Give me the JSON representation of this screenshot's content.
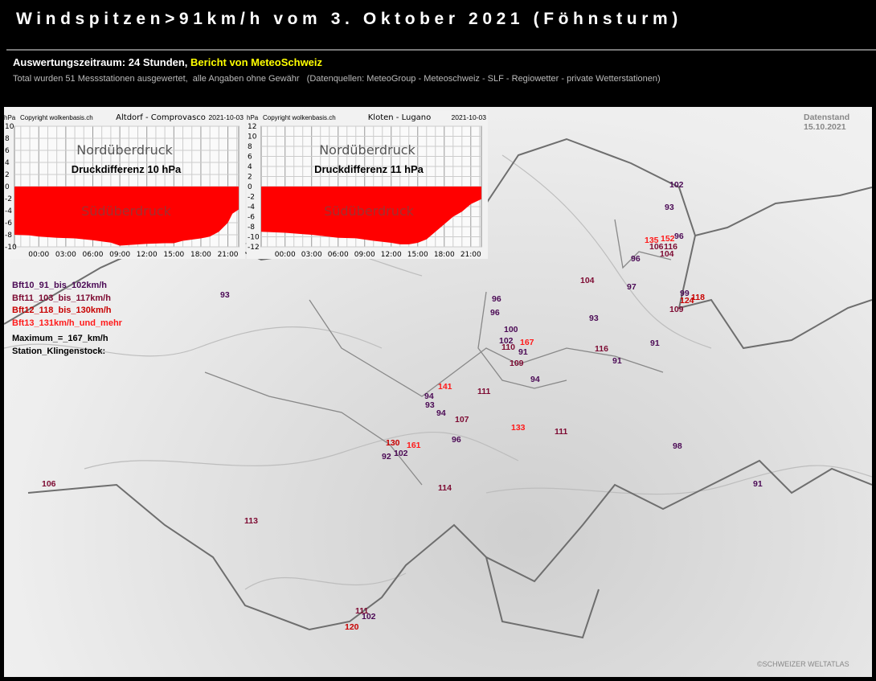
{
  "header": {
    "title": "Windspitzen>91km/h vom 3. Oktober 2021 (Föhnsturm)",
    "period": "Auswertungszeitraum: 24 Stunden,",
    "report": "Bericht von MeteoSchweiz",
    "info": "Total wurden 51 Messstationen ausgewertet,  alle Angaben ohne Gewähr   (Datenquellen: MeteoGroup - Meteoschweiz - SLF - Regiowetter - private Wetterstationen)"
  },
  "colors": {
    "bft10": "#4b0a55",
    "bft11": "#7d0a32",
    "bft12": "#c80000",
    "bft13": "#ff1a1a"
  },
  "legend": {
    "bft10": "Bft10_91_bis_102km/h",
    "bft11": "Bft11_103_bis_117km/h",
    "bft12": "Bft12_118_bis_130km/h",
    "bft13": "Bft13_131km/h_und_mehr",
    "maximum": "Maximum_=_167_km/h",
    "station": "Station_Klingenstock:"
  },
  "datenstand": {
    "label": "Datenstand",
    "date": "15.10.2021"
  },
  "copyright": "©SCHWEIZER WELTATLAS",
  "chart_data": [
    {
      "type": "area",
      "unit": "hPa",
      "copyright": "Copyright wolkenbasis.ch",
      "title": "Altdorf - Comprovasco",
      "date": "2021-10-03",
      "north_label": "Nordüberdruck",
      "south_label": "Südüberdruck",
      "annotation": "Druckdifferenz 10 hPa",
      "ylim": [
        -10,
        10
      ],
      "yticks": [
        "10",
        "8",
        "6",
        "4",
        "2",
        "0",
        "-2",
        "-4",
        "-6",
        "-8",
        "-10"
      ],
      "xticks": [
        "00:00",
        "03:00",
        "06:00",
        "09:00",
        "12:00",
        "15:00",
        "18:00",
        "21:00"
      ],
      "x_hours": [
        -2.7,
        -1,
        0,
        2,
        4,
        6,
        8,
        9,
        10,
        12,
        14,
        15,
        16,
        17,
        18,
        19,
        20,
        21,
        21.5,
        22.2
      ],
      "values": [
        -8,
        -8.1,
        -8.3,
        -8.5,
        -8.6,
        -8.9,
        -9.3,
        -9.8,
        -9.7,
        -9.5,
        -9.4,
        -9.4,
        -9.0,
        -8.8,
        -8.6,
        -8.3,
        -7.5,
        -6.0,
        -4.5,
        -3.8
      ]
    },
    {
      "type": "area",
      "unit": "hPa",
      "copyright": "Copyright wolkenbasis.ch",
      "title": "Kloten - Lugano",
      "date": "2021-10-03",
      "north_label": "Nordüberdruck",
      "south_label": "Südüberdruck",
      "annotation": "Druckdifferenz 11 hPa",
      "ylim": [
        -12,
        12
      ],
      "yticks": [
        "12",
        "10",
        "8",
        "6",
        "4",
        "2",
        "0",
        "-2",
        "-4",
        "-6",
        "-8",
        "-10",
        "-12"
      ],
      "xticks": [
        "00:00",
        "03:00",
        "06:00",
        "09:00",
        "12:00",
        "15:00",
        "18:00",
        "21:00"
      ],
      "x_hours": [
        -2.7,
        0,
        3,
        6,
        8,
        10,
        12,
        13,
        14,
        15,
        16,
        17,
        18,
        19,
        20,
        21,
        22.2
      ],
      "values": [
        -9,
        -9.2,
        -9.6,
        -10.2,
        -10.3,
        -10.8,
        -11.2,
        -11.5,
        -11.5,
        -11.2,
        -10.5,
        -9.0,
        -7.5,
        -6.0,
        -5.0,
        -3.5,
        -2.5
      ]
    }
  ],
  "stations": [
    {
      "value": "102",
      "bft": 10
    },
    {
      "value": "93",
      "bft": 10
    },
    {
      "value": "135",
      "bft": 13
    },
    {
      "value": "152",
      "bft": 13
    },
    {
      "value": "96",
      "bft": 10
    },
    {
      "value": "106",
      "bft": 11
    },
    {
      "value": "116",
      "bft": 11
    },
    {
      "value": "104",
      "bft": 11
    },
    {
      "value": "96",
      "bft": 10
    },
    {
      "value": "97",
      "bft": 10
    },
    {
      "value": "99",
      "bft": 10
    },
    {
      "value": "124",
      "bft": 12
    },
    {
      "value": "118",
      "bft": 12
    },
    {
      "value": "109",
      "bft": 11
    },
    {
      "value": "104",
      "bft": 11
    },
    {
      "value": "93",
      "bft": 10
    },
    {
      "value": "116",
      "bft": 11
    },
    {
      "value": "91",
      "bft": 10
    },
    {
      "value": "91",
      "bft": 10
    },
    {
      "value": "96",
      "bft": 10
    },
    {
      "value": "96",
      "bft": 10
    },
    {
      "value": "100",
      "bft": 10
    },
    {
      "value": "102",
      "bft": 10
    },
    {
      "value": "110",
      "bft": 11
    },
    {
      "value": "167",
      "bft": 13
    },
    {
      "value": "91",
      "bft": 10
    },
    {
      "value": "109",
      "bft": 11
    },
    {
      "value": "94",
      "bft": 10
    },
    {
      "value": "141",
      "bft": 13
    },
    {
      "value": "111",
      "bft": 11
    },
    {
      "value": "94",
      "bft": 10
    },
    {
      "value": "93",
      "bft": 10
    },
    {
      "value": "94",
      "bft": 10
    },
    {
      "value": "107",
      "bft": 11
    },
    {
      "value": "96",
      "bft": 10
    },
    {
      "value": "133",
      "bft": 13
    },
    {
      "value": "111",
      "bft": 11
    },
    {
      "value": "130",
      "bft": 12
    },
    {
      "value": "161",
      "bft": 13
    },
    {
      "value": "92",
      "bft": 10
    },
    {
      "value": "102",
      "bft": 10
    },
    {
      "value": "114",
      "bft": 11
    },
    {
      "value": "98",
      "bft": 10
    },
    {
      "value": "91",
      "bft": 10
    },
    {
      "value": "93",
      "bft": 10
    },
    {
      "value": "106",
      "bft": 11
    },
    {
      "value": "113",
      "bft": 11
    },
    {
      "value": "111",
      "bft": 11
    },
    {
      "value": "102",
      "bft": 10
    },
    {
      "value": "120",
      "bft": 12
    }
  ]
}
